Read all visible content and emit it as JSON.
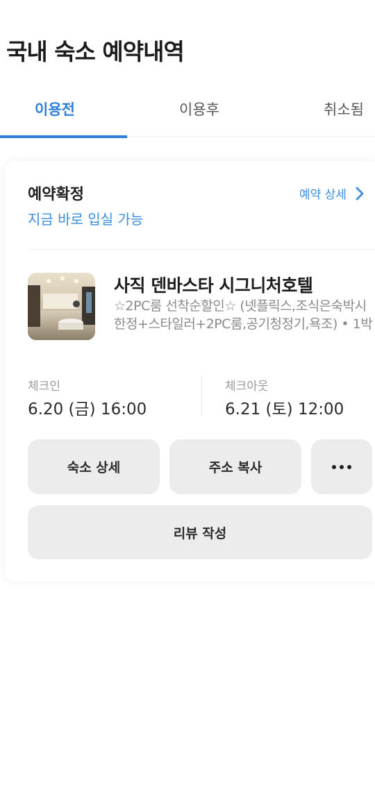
{
  "header": {
    "title": "국내 숙소 예약내역"
  },
  "tabs": [
    {
      "label": "이용전",
      "active": true
    },
    {
      "label": "이용후",
      "active": false
    },
    {
      "label": "취소됨",
      "active": false
    }
  ],
  "reservation": {
    "status": "예약확정",
    "status_sub": "지금 바로 입실 가능",
    "detail_link": "예약 상세",
    "hotel_name": "사직 덴바스타 시그니처호텔",
    "room_desc": "☆2PC룸 선착순할인☆ (넷플릭스,조식은숙박시 한정+스타일러+2PC룸,공기청정기,욕조) • 1박",
    "checkin": {
      "label": "체크인",
      "value": "6.20 (금) 16:00"
    },
    "checkout": {
      "label": "체크아웃",
      "value": "6.21 (토) 12:00"
    },
    "buttons": {
      "stay_detail": "숙소 상세",
      "copy_address": "주소 복사",
      "write_review": "리뷰 작성"
    }
  },
  "colors": {
    "accent": "#2f7fd8",
    "link": "#3a8ee0",
    "button_bg": "#ececec"
  }
}
